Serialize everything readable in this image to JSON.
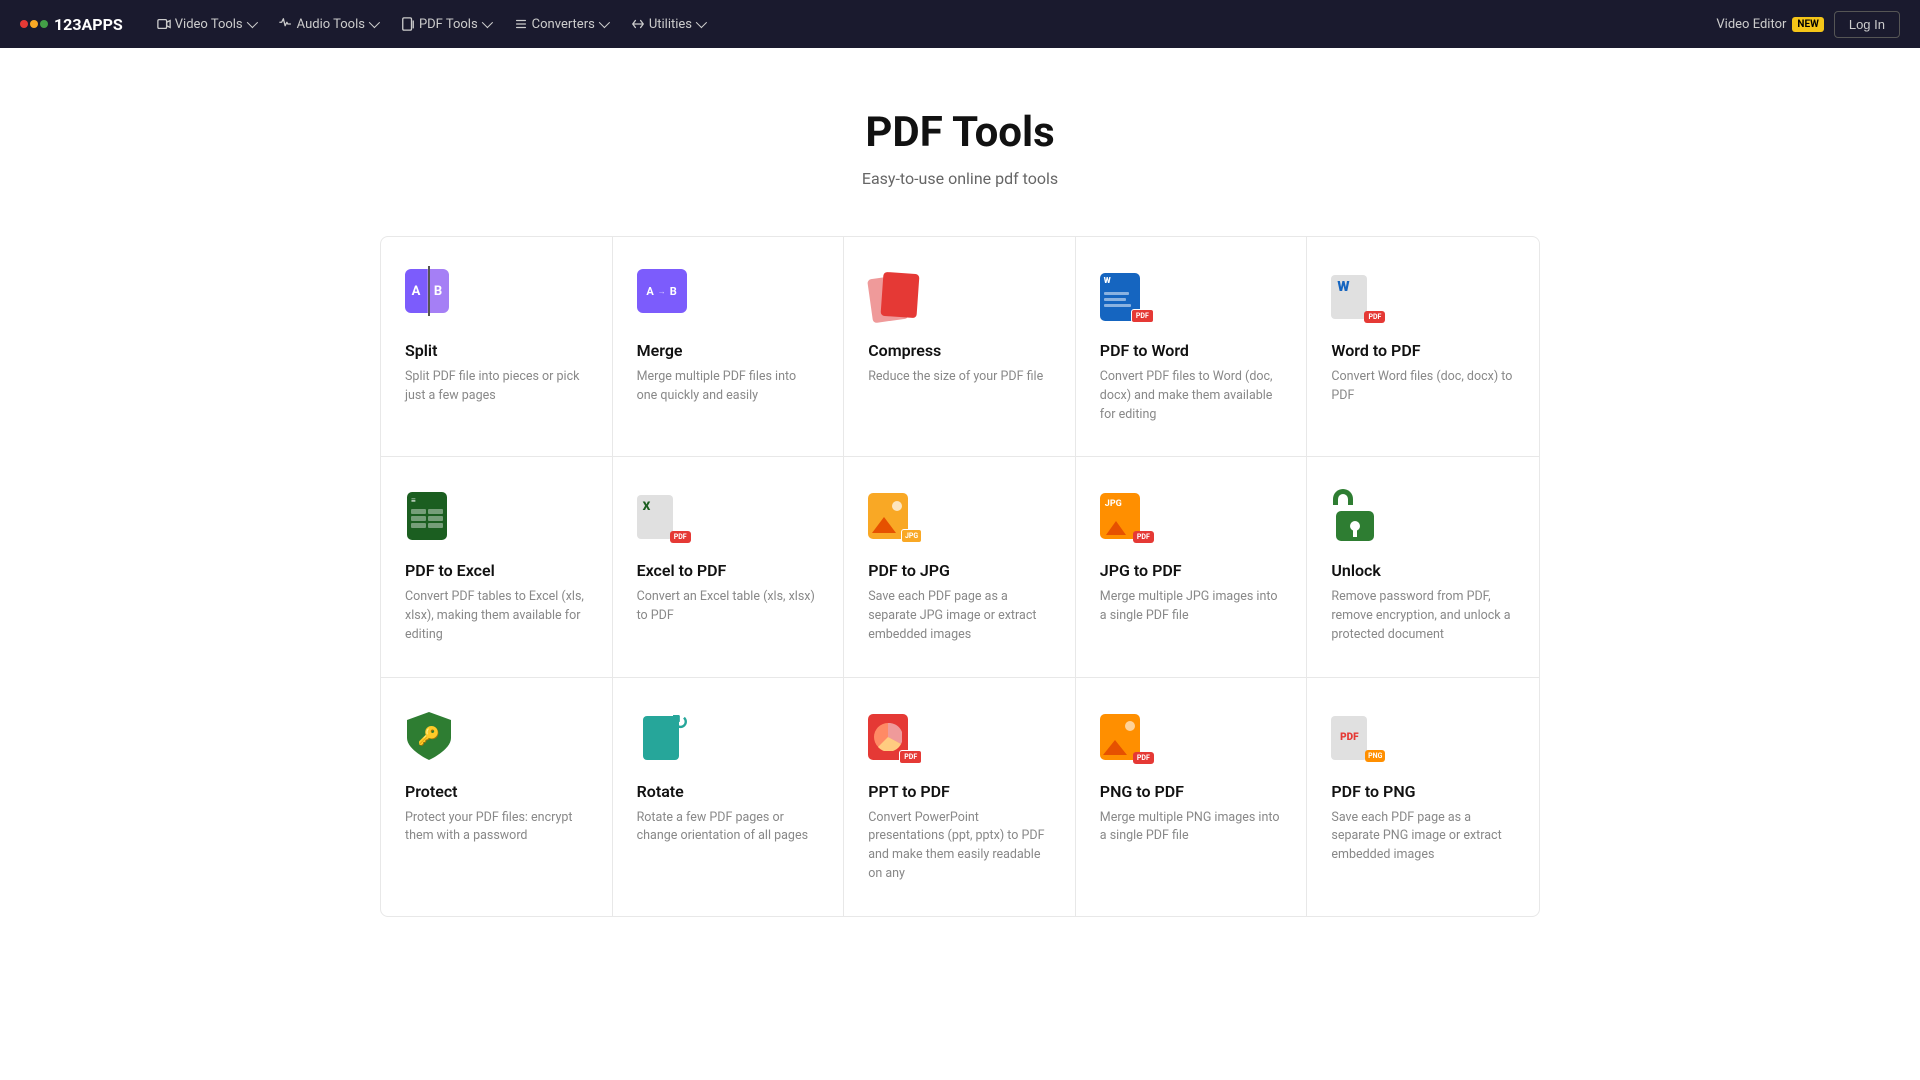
{
  "app": {
    "name": "123APPS",
    "tagline": "Video Editor",
    "badge": "NEW",
    "login": "Log In"
  },
  "nav": {
    "items": [
      {
        "id": "video-tools",
        "label": "Video Tools"
      },
      {
        "id": "audio-tools",
        "label": "Audio Tools"
      },
      {
        "id": "pdf-tools",
        "label": "PDF Tools"
      },
      {
        "id": "converters",
        "label": "Converters"
      },
      {
        "id": "utilities",
        "label": "Utilities"
      }
    ]
  },
  "page": {
    "title": "PDF Tools",
    "subtitle": "Easy-to-use online pdf tools"
  },
  "tools": [
    {
      "id": "split",
      "name": "Split",
      "desc": "Split PDF file into pieces or pick just a few pages"
    },
    {
      "id": "merge",
      "name": "Merge",
      "desc": "Merge multiple PDF files into one quickly and easily"
    },
    {
      "id": "compress",
      "name": "Compress",
      "desc": "Reduce the size of your PDF file"
    },
    {
      "id": "pdf-to-word",
      "name": "PDF to Word",
      "desc": "Convert PDF files to Word (doc, docx) and make them available for editing"
    },
    {
      "id": "word-to-pdf",
      "name": "Word to PDF",
      "desc": "Convert Word files (doc, docx) to PDF"
    },
    {
      "id": "pdf-to-excel",
      "name": "PDF to Excel",
      "desc": "Convert PDF tables to Excel (xls, xlsx), making them available for editing"
    },
    {
      "id": "excel-to-pdf",
      "name": "Excel to PDF",
      "desc": "Convert an Excel table (xls, xlsx) to PDF"
    },
    {
      "id": "pdf-to-jpg",
      "name": "PDF to JPG",
      "desc": "Save each PDF page as a separate JPG image or extract embedded images"
    },
    {
      "id": "jpg-to-pdf",
      "name": "JPG to PDF",
      "desc": "Merge multiple JPG images into a single PDF file"
    },
    {
      "id": "unlock",
      "name": "Unlock",
      "desc": "Remove password from PDF, remove encryption, and unlock a protected document"
    },
    {
      "id": "protect",
      "name": "Protect",
      "desc": "Protect your PDF files: encrypt them with a password"
    },
    {
      "id": "rotate",
      "name": "Rotate",
      "desc": "Rotate a few PDF pages or change orientation of all pages"
    },
    {
      "id": "ppt-to-pdf",
      "name": "PPT to PDF",
      "desc": "Convert PowerPoint presentations (ppt, pptx) to PDF and make them easily readable on any"
    },
    {
      "id": "png-to-pdf",
      "name": "PNG to PDF",
      "desc": "Merge multiple PNG images into a single PDF file"
    },
    {
      "id": "pdf-to-png",
      "name": "PDF to PNG",
      "desc": "Save each PDF page as a separate PNG image or extract embedded images"
    }
  ]
}
